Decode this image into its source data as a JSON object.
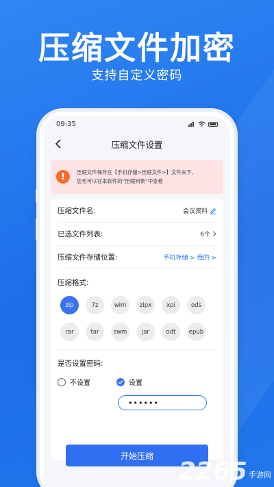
{
  "hero": {
    "title": "压缩文件加密",
    "subtitle": "支持自定义密码"
  },
  "status_bar": {
    "time": "09:35"
  },
  "nav": {
    "title": "压缩文件设置"
  },
  "notice": {
    "line1": "压缩文件保存在【手机存储>压缩文件>】文件夹下,",
    "line2": "您也可以在本软件的“压缩列表”中查看"
  },
  "form": {
    "name_label": "压缩文件名:",
    "name_value": "会议资料",
    "list_label": "已选文件列表:",
    "list_value": "6个",
    "location_label": "压缩文件存储位置:",
    "location_value": "手机存储 > 我的 >",
    "format_label": "压缩格式:",
    "formats": [
      "zip",
      "7z",
      "wim",
      "zipx",
      "xpi",
      "ods",
      "rar",
      "tar",
      "swm",
      "jar",
      "odt",
      "epub"
    ],
    "selected_format": "zip",
    "password_label": "是否设置密码:",
    "option_no": "不设置",
    "option_yes": "设置",
    "selected_option": "设置",
    "password_value": "••••••"
  },
  "actions": {
    "start_label": "开始压缩"
  },
  "watermark": {
    "number": "2265",
    "text": "手游网"
  },
  "colors": {
    "primary": "#2f6ff2",
    "notice_bg": "#fde3e3",
    "warning": "#f26b30"
  }
}
